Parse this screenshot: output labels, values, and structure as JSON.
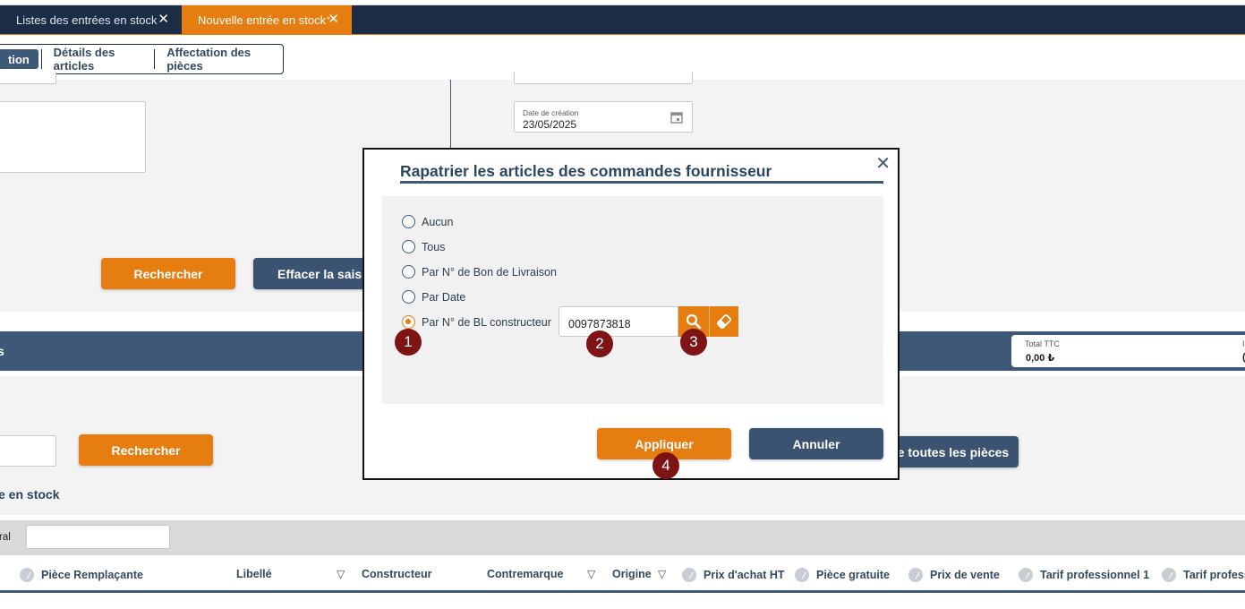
{
  "tabs": [
    {
      "label": "Listes des entrées en stock",
      "close": "✕"
    },
    {
      "label": "Nouvelle entrée en stock",
      "marker": "*",
      "close": "✕"
    }
  ],
  "subtabs": [
    "tion",
    "Détails des articles",
    "Affectation des pièces"
  ],
  "left": {
    "search_button": "Rechercher",
    "clear_button": "Effacer la saisie"
  },
  "right": {
    "date_label": "Date de création",
    "date_value": "23/05/2025"
  },
  "band": {
    "left_fragment": "s",
    "total_label": "Total TTC",
    "total_value": "0,00 ₺",
    "right_label_fragment": "I",
    "right_value_fragment": "("
  },
  "lower": {
    "search_button": "Rechercher",
    "all_pieces_button": "le toutes les pièces",
    "section_title": "e en stock",
    "filter_label": "ral"
  },
  "columns": [
    "Pièce Remplaçante",
    "Libellé",
    "Constructeur",
    "Contremarque",
    "Origine",
    "Prix d'achat HT",
    "Pièce gratuite",
    "Prix de vente",
    "Tarif professionnel 1",
    "Tarif profess"
  ],
  "modal": {
    "title": "Rapatrier les articles des commandes fournisseur",
    "close": "✕",
    "options": [
      "Aucun",
      "Tous",
      "Par N° de Bon de Livraison",
      "Par Date",
      "Par N° de BL constructeur"
    ],
    "selected_option": "Par N° de BL constructeur",
    "bl_value": "0097873818",
    "apply_button": "Appliquer",
    "cancel_button": "Annuler"
  },
  "markers": [
    "1",
    "2",
    "3",
    "4"
  ],
  "colors": {
    "accent": "#e57d11",
    "navy": "#3e5878",
    "dark": "#1c2c44",
    "marker": "#7e1414"
  },
  "icons": [
    "close-icon",
    "calendar-icon",
    "search-icon",
    "eraser-icon",
    "filter-icon",
    "edit-icon",
    "chat-icon"
  ]
}
